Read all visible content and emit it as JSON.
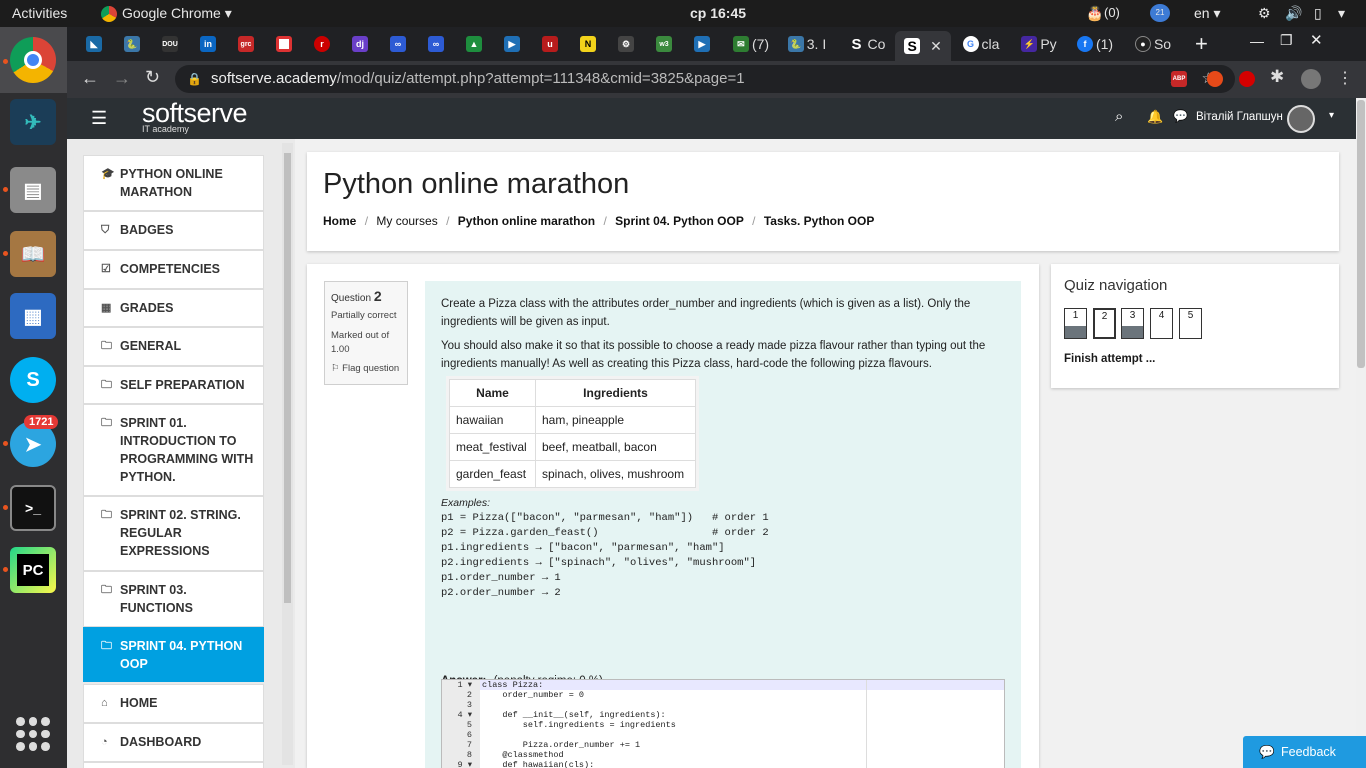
{
  "system": {
    "activities": "Activities",
    "app": "Google Chrome",
    "clock": "ср 16:45",
    "notif_count": "(0)",
    "badge": "21",
    "lang": "en"
  },
  "dock": {
    "telegram_badge": "1721",
    "pycharm": "PC"
  },
  "tabs": {
    "t1": "(7)",
    "t2": "3. I",
    "t3": "Co",
    "t4": "cla",
    "t5": "Py",
    "t6": "(1)",
    "t7": "So"
  },
  "address": {
    "url_host": "softserve.academy",
    "url_path": "/mod/quiz/attempt.php?attempt=111348&cmid=3825&page=1"
  },
  "header": {
    "brand": "softserve",
    "brand_sub": "IT academy",
    "user": "Віталій Глапшун"
  },
  "nav": [
    "PYTHON ONLINE MARATHON",
    "BADGES",
    "COMPETENCIES",
    "GRADES",
    "GENERAL",
    "SELF PREPARATION",
    "SPRINT 01. INTRODUCTION TO PROGRAMMING WITH PYTHON.",
    "SPRINT 02. STRING. REGULAR EXPRESSIONS",
    "SPRINT 03. FUNCTIONS",
    "SPRINT 04. PYTHON OOP",
    "HOME",
    "DASHBOARD"
  ],
  "page": {
    "title": "Python online marathon",
    "crumbs": [
      "Home",
      "My courses",
      "Python online marathon",
      "Sprint 04. Python OOP",
      "Tasks. Python OOP"
    ]
  },
  "question": {
    "label": "Question",
    "num": "2",
    "state": "Partially correct",
    "marked": "Marked out of 1.00",
    "flag": "Flag question",
    "p1": "Create a Pizza class with the attributes order_number and ingredients (which is given as a list). Only the ingredients will be given as input.",
    "p2": "You should also make it so that its possible to choose a ready made pizza flavour rather than typing out the ingredients manually! As well as creating this Pizza class, hard-code the following pizza flavours.",
    "table": {
      "headers": [
        "Name",
        "Ingredients"
      ],
      "rows": [
        [
          "hawaiian",
          "ham, pineapple"
        ],
        [
          "meat_festival",
          "beef, meatball, bacon"
        ],
        [
          "garden_feast",
          "spinach, olives, mushroom"
        ]
      ]
    },
    "examples_label": "Examples:",
    "examples": "p1 = Pizza([\"bacon\", \"parmesan\", \"ham\"])   # order 1\np2 = Pizza.garden_feast()                  # order 2\np1.ingredients → [\"bacon\", \"parmesan\", \"ham\"]\np2.ingredients → [\"spinach\", \"olives\", \"mushroom\"]\np1.order_number → 1\np2.order_number → 2",
    "answer_label": "Answer:",
    "penalty": "(penalty regime: 0 %)",
    "code_gutter": "1 ▾\n2\n3\n4 ▾\n5\n6\n7\n8\n9 ▾",
    "code": "class Pizza:\n    order_number = 0\n\n    def __init__(self, ingredients):\n        self.ingredients = ingredients\n\n        Pizza.order_number += 1\n    @classmethod\n    def hawaiian(cls):"
  },
  "quiz_nav": {
    "title": "Quiz navigation",
    "buttons": [
      "1",
      "2",
      "3",
      "4",
      "5"
    ],
    "finish": "Finish attempt ..."
  },
  "feedback": "Feedback"
}
